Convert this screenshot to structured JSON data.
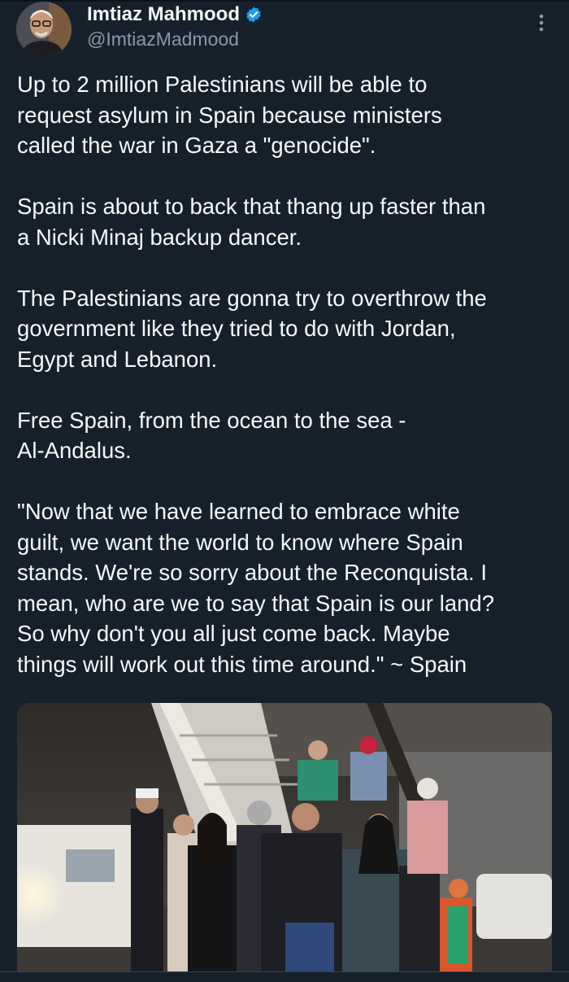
{
  "author": {
    "display_name": "Imtiaz Mahmood",
    "handle": "@ImtiazMadmood",
    "verified": true,
    "avatar_icon": "profile-photo"
  },
  "menu_icon": "more-vertical-icon",
  "tweet": {
    "paragraphs": [
      "Up to 2 million Palestinians will be able to\nrequest asylum in Spain because ministers\ncalled the war in Gaza a \"genocide\".",
      "Spain is about to back that thang up faster than\na Nicki Minaj backup dancer.",
      "The Palestinians are gonna try to overthrow the\ngovernment like they tried to do with Jordan,\nEgypt and Lebanon.",
      "Free Spain, from the ocean to the sea -\nAl-Andalus.",
      "\"Now that we have learned to embrace white\nguilt, we want the world to know where Spain\nstands. We're so sorry about the Reconquista. I\nmean, who are we to say that Spain is our land?\nSo why don't you all just come back. Maybe\nthings will work out this time around.\" ~ Spain"
    ]
  },
  "media": {
    "type": "photo"
  },
  "colors": {
    "background": "#15202b",
    "text": "#f7f9f9",
    "secondary_text": "#8b98a5",
    "verified_badge": "#1d9bf0"
  }
}
